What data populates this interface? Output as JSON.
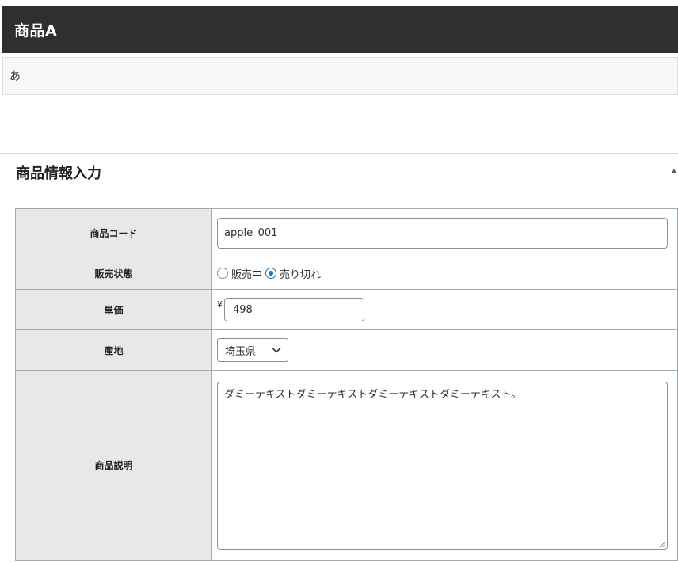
{
  "title_bar": {
    "title": "商品A"
  },
  "text_area": {
    "value": "あ"
  },
  "section": {
    "heading": "商品情報入力",
    "toggle_glyph": "▲"
  },
  "form": {
    "product_code": {
      "label": "商品コード",
      "value": "apple_001"
    },
    "sale_status": {
      "label": "販売状態",
      "options": [
        "販売中",
        "売り切れ"
      ],
      "selected": "売り切れ"
    },
    "unit_price": {
      "label": "単価",
      "currency": "¥",
      "value": "498"
    },
    "origin": {
      "label": "産地",
      "selected": "埼玉県"
    },
    "description": {
      "label": "商品説明",
      "value": "ダミーテキストダミーテキストダミーテキストダミーテキスト。"
    }
  },
  "icons": {
    "toggle": "triangle-up-icon",
    "select": "chevron-down-icon",
    "resize": "resize-grip-icon"
  },
  "colors": {
    "title_bar_bg": "#2f2f2f",
    "radio_accent": "#2271b1",
    "label_cell_bg": "#e8e8e8"
  }
}
